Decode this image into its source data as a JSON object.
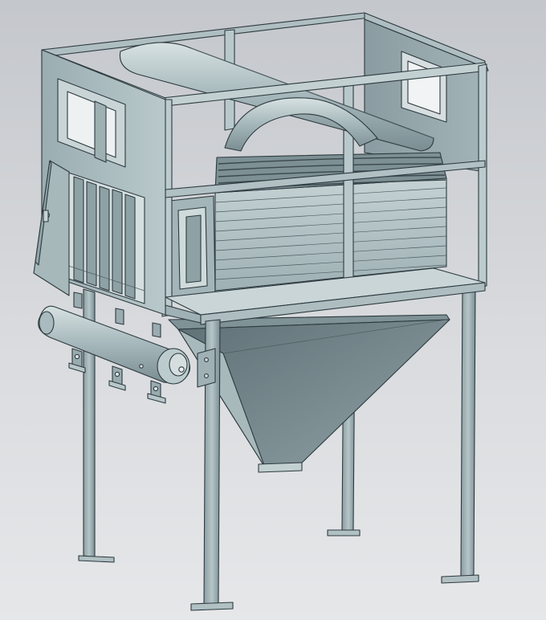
{
  "scene": {
    "background_top": "#c4c7cc",
    "background_bottom": "#e6e7e9",
    "metal_light": "#b3c4c6",
    "metal_mid": "#91a4a8",
    "metal_dark": "#6f8287",
    "edge_color": "#2d3a3f",
    "subject": "cad-model-grain-dryer-hopper"
  }
}
